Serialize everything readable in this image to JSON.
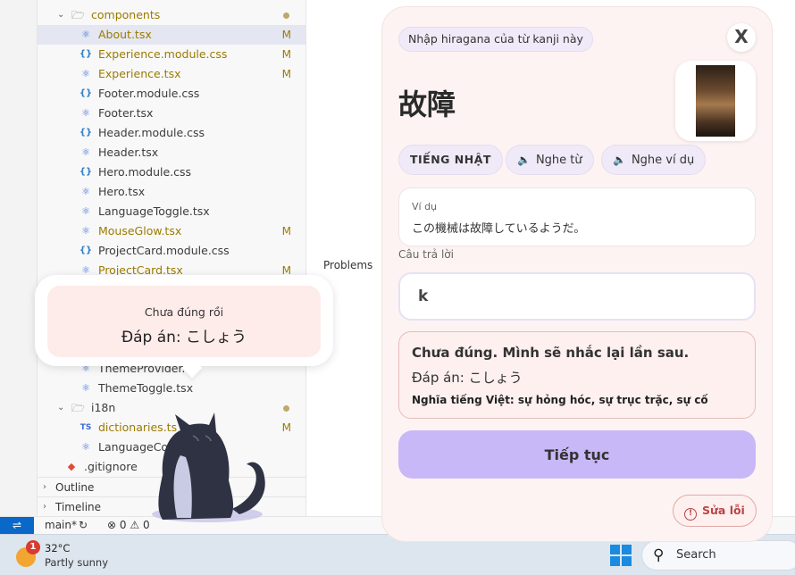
{
  "explorer": {
    "rows": [
      {
        "name": "components",
        "status": "dot",
        "kind": "folder"
      },
      {
        "name": "About.tsx",
        "status": "M",
        "kind": "react"
      },
      {
        "name": "Experience.module.css",
        "status": "M",
        "kind": "css"
      },
      {
        "name": "Experience.tsx",
        "status": "M",
        "kind": "react"
      },
      {
        "name": "Footer.module.css",
        "status": "",
        "kind": "css"
      },
      {
        "name": "Footer.tsx",
        "status": "",
        "kind": "react"
      },
      {
        "name": "Header.module.css",
        "status": "",
        "kind": "css"
      },
      {
        "name": "Header.tsx",
        "status": "",
        "kind": "react"
      },
      {
        "name": "Hero.module.css",
        "status": "",
        "kind": "css"
      },
      {
        "name": "Hero.tsx",
        "status": "",
        "kind": "react"
      },
      {
        "name": "LanguageToggle.tsx",
        "status": "",
        "kind": "react"
      },
      {
        "name": "MouseGlow.tsx",
        "status": "M",
        "kind": "react"
      },
      {
        "name": "ProjectCard.module.css",
        "status": "",
        "kind": "css"
      },
      {
        "name": "ProjectCard.tsx",
        "status": "M",
        "kind": "react"
      },
      {
        "name": "ThemeProvider.t",
        "status": "",
        "kind": "react"
      },
      {
        "name": "ThemeToggle.tsx",
        "status": "",
        "kind": "react"
      },
      {
        "name": "i18n",
        "status": "dot",
        "kind": "folder"
      },
      {
        "name": "dictionaries.ts",
        "status": "M",
        "kind": "ts"
      },
      {
        "name": "LanguageCon",
        "status": "",
        "kind": "react"
      },
      {
        "name": ".gitignore",
        "status": "",
        "kind": "git"
      }
    ],
    "sections": [
      "Outline",
      "Timeline"
    ]
  },
  "panel": {
    "problems_tab": "Problems"
  },
  "statusbar": {
    "branch": "main*",
    "errors": "0",
    "warnings": "0"
  },
  "taskbar": {
    "weather_temp": "32°C",
    "weather_condition": "Partly sunny",
    "weather_badge": "1",
    "search_label": "Search"
  },
  "toast": {
    "title": "Chưa đúng rồi",
    "answer": "Đáp án: こしょう"
  },
  "quiz": {
    "prompt": "Nhập hiragana của từ kanji này",
    "close_label": "X",
    "kanji": "故障",
    "chips": {
      "language": "TIẾNG NHẬT",
      "listen_word": "Nghe từ",
      "listen_example": "Nghe ví dụ"
    },
    "example_label": "Ví dụ",
    "example_text": "この機械は故障しているようだ。",
    "answer_label": "Câu trả lời",
    "answer_value": "k",
    "feedback": {
      "line1": "Chưa đúng. Mình sẽ nhắc lại lần sau.",
      "line2": "Đáp án: こしょう",
      "line3": "Nghĩa tiếng Việt: sự hỏng hóc, sự trục trặc, sự cố"
    },
    "continue_label": "Tiếp tục",
    "report_label": "Sửa lỗi"
  },
  "colors": {
    "accent_button": "#c9b8f8",
    "panel_bg": "#fdf3f2",
    "error_border": "#e5bdbb",
    "modified": "#9a7b00",
    "remote_indicator": "#0a68c8"
  }
}
